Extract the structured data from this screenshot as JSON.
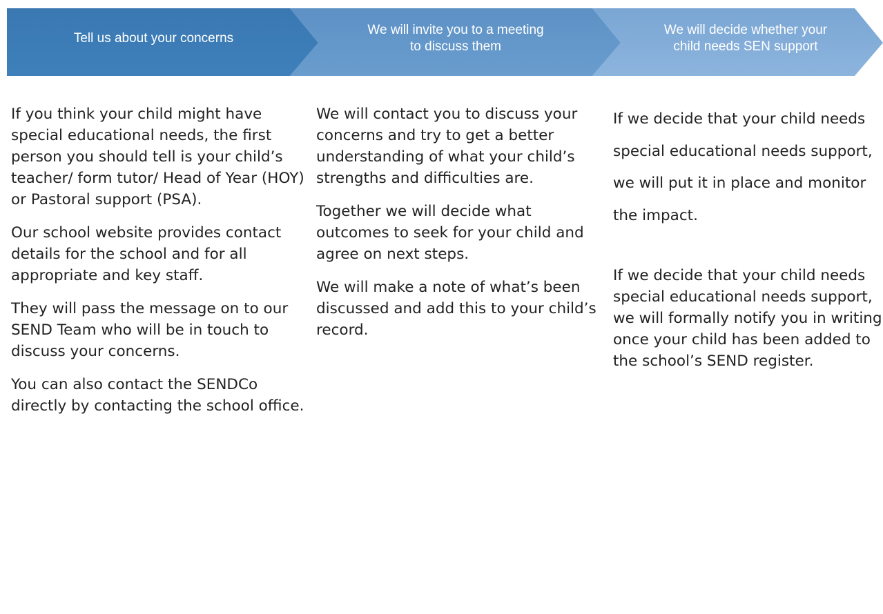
{
  "process_banner": {
    "stages": [
      {
        "label": "Tell us about your concerns"
      },
      {
        "label": "We will invite you to a meeting\nto discuss them"
      },
      {
        "label": "We will decide whether your\nchild needs SEN support"
      }
    ],
    "colors": {
      "stage1_top": "#2f72ad",
      "stage1_bottom": "#3c7fb8",
      "stage2_top": "#5a8fc4",
      "stage2_bottom": "#6d9fd0",
      "stage3_top": "#7aa6d4",
      "stage3_bottom": "#8eb5de"
    }
  },
  "columns": [
    {
      "paragraphs": [
        "If you think your child might have special educational needs, the first person you should tell is your child’s teacher/ form tutor/ Head of Year (HOY) or Pastoral support (PSA).",
        "Our school website provides contact details for the school and for all appropriate and key staff.",
        "They will pass the message on to our SEND Team who will be in touch to discuss your concerns.",
        "You can also contact the SENDCo directly by contacting the school office."
      ]
    },
    {
      "paragraphs": [
        "We will contact you to discuss your concerns and try to get a better understanding of what your child’s strengths and difficulties are.",
        "Together we will decide what outcomes to seek for your child and agree on next steps.",
        "We will make a note of what’s been discussed and add this to your child’s record."
      ]
    },
    {
      "paragraphs": [
        "If we decide that your child needs special educational needs support, we will put it in place and monitor the impact.",
        "If we decide that your child needs special educational needs support, we will formally notify you in writing once your child has been added to the school’s SEND register."
      ]
    }
  ]
}
